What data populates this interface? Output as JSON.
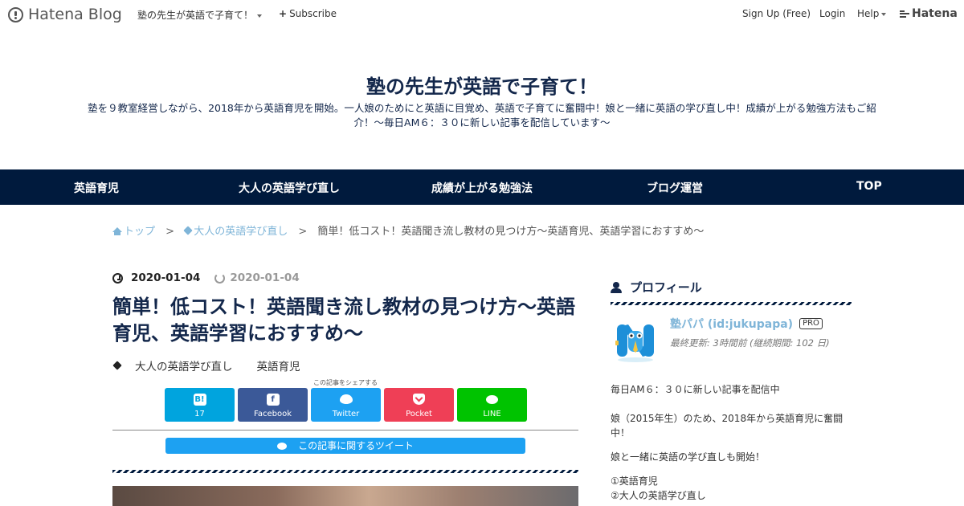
{
  "topbar": {
    "brand": "Hatena Blog",
    "blog_menu": "塾の先生が英語で子育て！",
    "subscribe": "Subscribe",
    "signup": "Sign Up (Free)",
    "login": "Login",
    "help": "Help",
    "hatena": "Hatena"
  },
  "blog": {
    "title": "塾の先生が英語で子育て！",
    "description": "塾を９教室経営しながら、2018年から英語育児を開始。一人娘のためにと英語に目覚め、英語で子育てに奮闘中！娘と一緒に英語の学び直し中！成績が上がる勉強方法もご紹介！～毎日AM６：３０に新しい記事を配信しています～"
  },
  "nav": {
    "items": [
      {
        "label": "英語育児"
      },
      {
        "label": "大人の英語学び直し"
      },
      {
        "label": "成績が上がる勉強法"
      },
      {
        "label": "ブログ運営"
      },
      {
        "label": "TOP"
      }
    ]
  },
  "breadcrumb": {
    "home": "トップ",
    "separator": ">",
    "category": "大人の英語学び直し",
    "current": "簡単！低コスト！英語聞き流し教材の見つけ方～英語育児、英語学習におすすめ～"
  },
  "article": {
    "published": "2020-01-04",
    "updated": "2020-01-04",
    "title": "簡単！低コスト！英語聞き流し教材の見つけ方～英語育児、英語学習におすすめ～",
    "tags": [
      "大人の英語学び直し",
      "英語育児"
    ]
  },
  "share": {
    "caption": "この記事をシェアする",
    "hatena_icon": "B!",
    "hatena_count": "17",
    "facebook": "Facebook",
    "facebook_icon": "f",
    "twitter": "Twitter",
    "pocket": "Pocket",
    "line": "LINE",
    "tweet_about": "この記事に関するツイート"
  },
  "sidebar": {
    "heading": "プロフィール",
    "name": "塾パパ (id:jukupapa)",
    "badge": "PRO",
    "meta": "最終更新: 3時間前 (継続期間: 102 日)",
    "bio": [
      "毎日AM６：３０に新しい記事を配信中",
      "娘（2015年生）のため、2018年から英語育児に奮闘中！",
      "娘と一緒に英語の学び直しも開始！",
      "①英語育児",
      "②大人の英語学び直し"
    ]
  },
  "colors": {
    "navy": "#001a3d",
    "title_navy": "#13274b",
    "link_blue": "#7fb5d8",
    "hatena": "#00a4de",
    "facebook": "#3b5998",
    "twitter": "#1da1f2",
    "pocket": "#ef3f56",
    "line": "#00c300"
  },
  "icons": [
    "hatena-blog-logo-icon",
    "caret-down-icon",
    "plus-icon",
    "home-icon",
    "tag-icon",
    "clock-icon",
    "refresh-icon",
    "hatena-bookmark-icon",
    "facebook-icon",
    "twitter-icon",
    "pocket-icon",
    "line-icon",
    "user-icon"
  ]
}
